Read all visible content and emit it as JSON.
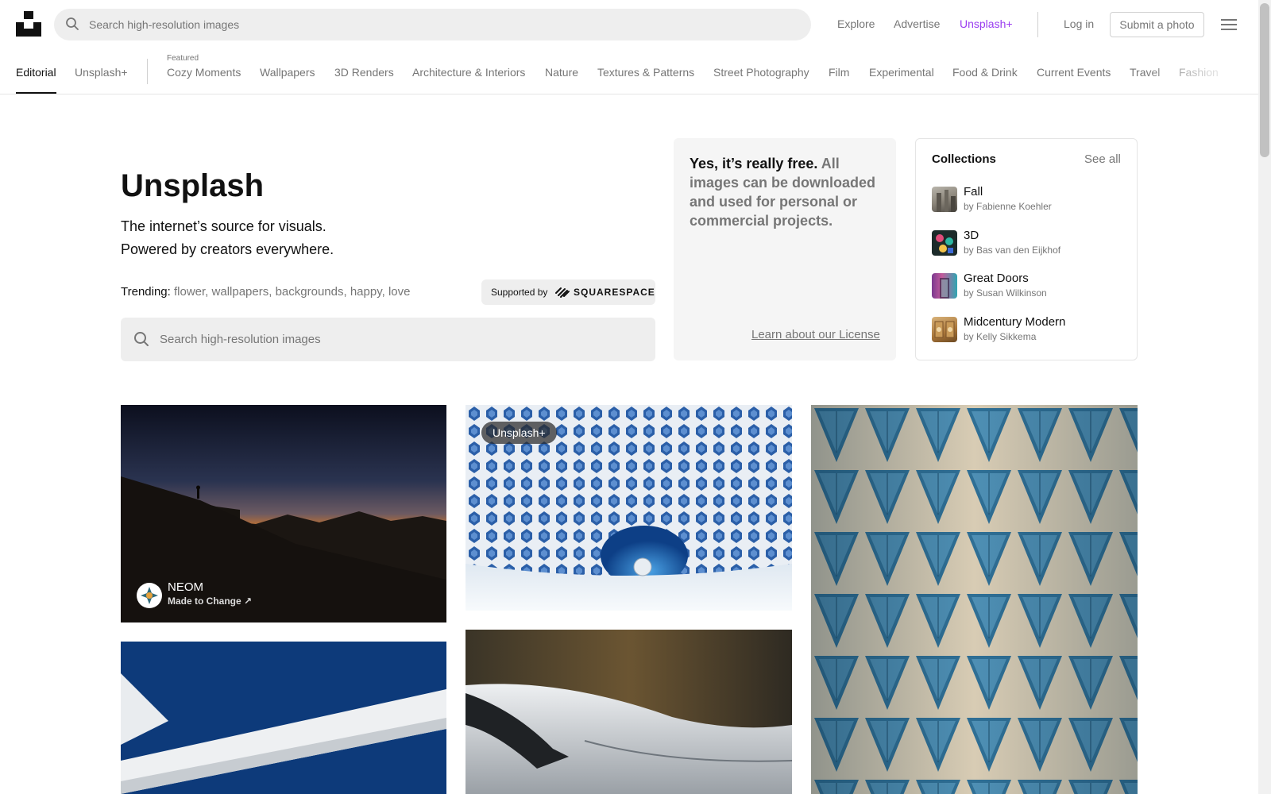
{
  "header": {
    "search_placeholder": "Search high-resolution images",
    "nav": {
      "explore": "Explore",
      "advertise": "Advertise",
      "unsplash_plus": "Unsplash+",
      "login": "Log in",
      "submit": "Submit a photo"
    }
  },
  "topics": {
    "editorial": "Editorial",
    "unsplash_plus": "Unsplash+",
    "featured_label": "Featured",
    "items": [
      "Cozy Moments",
      "Wallpapers",
      "3D Renders",
      "Architecture & Interiors",
      "Nature",
      "Textures & Patterns",
      "Street Photography",
      "Film",
      "Experimental",
      "Food & Drink",
      "Current Events",
      "Travel",
      "Fashion"
    ]
  },
  "hero": {
    "title": "Unsplash",
    "subtitle_1": "The internet’s source for visuals.",
    "subtitle_2": "Powered by creators everywhere.",
    "trending_label": "Trending:",
    "trending": [
      "flower",
      "wallpapers",
      "backgrounds",
      "happy",
      "love"
    ],
    "supported_by": "Supported by",
    "sponsor": "SQUARESPACE",
    "search_placeholder": "Search high-resolution images"
  },
  "free_card": {
    "strong": "Yes, it’s really free.",
    "rest": "All images can be downloaded and used for personal or commercial projects.",
    "link": "Learn about our License"
  },
  "collections": {
    "title": "Collections",
    "see_all": "See all",
    "items": [
      {
        "name": "Fall",
        "by": "by Fabienne Koehler"
      },
      {
        "name": "3D",
        "by": "by Bas van den Eijkhof"
      },
      {
        "name": "Great Doors",
        "by": "by Susan Wilkinson"
      },
      {
        "name": "Midcentury Modern",
        "by": "by Kelly Sikkema"
      }
    ]
  },
  "photos": {
    "sponsor_name": "NEOM",
    "sponsor_tag": "Made to Change ↗",
    "plus_badge": "Unsplash+"
  },
  "colors": {
    "accent_plus": "#9a3df0",
    "muted_text": "#767676",
    "primary_text": "#111111"
  }
}
